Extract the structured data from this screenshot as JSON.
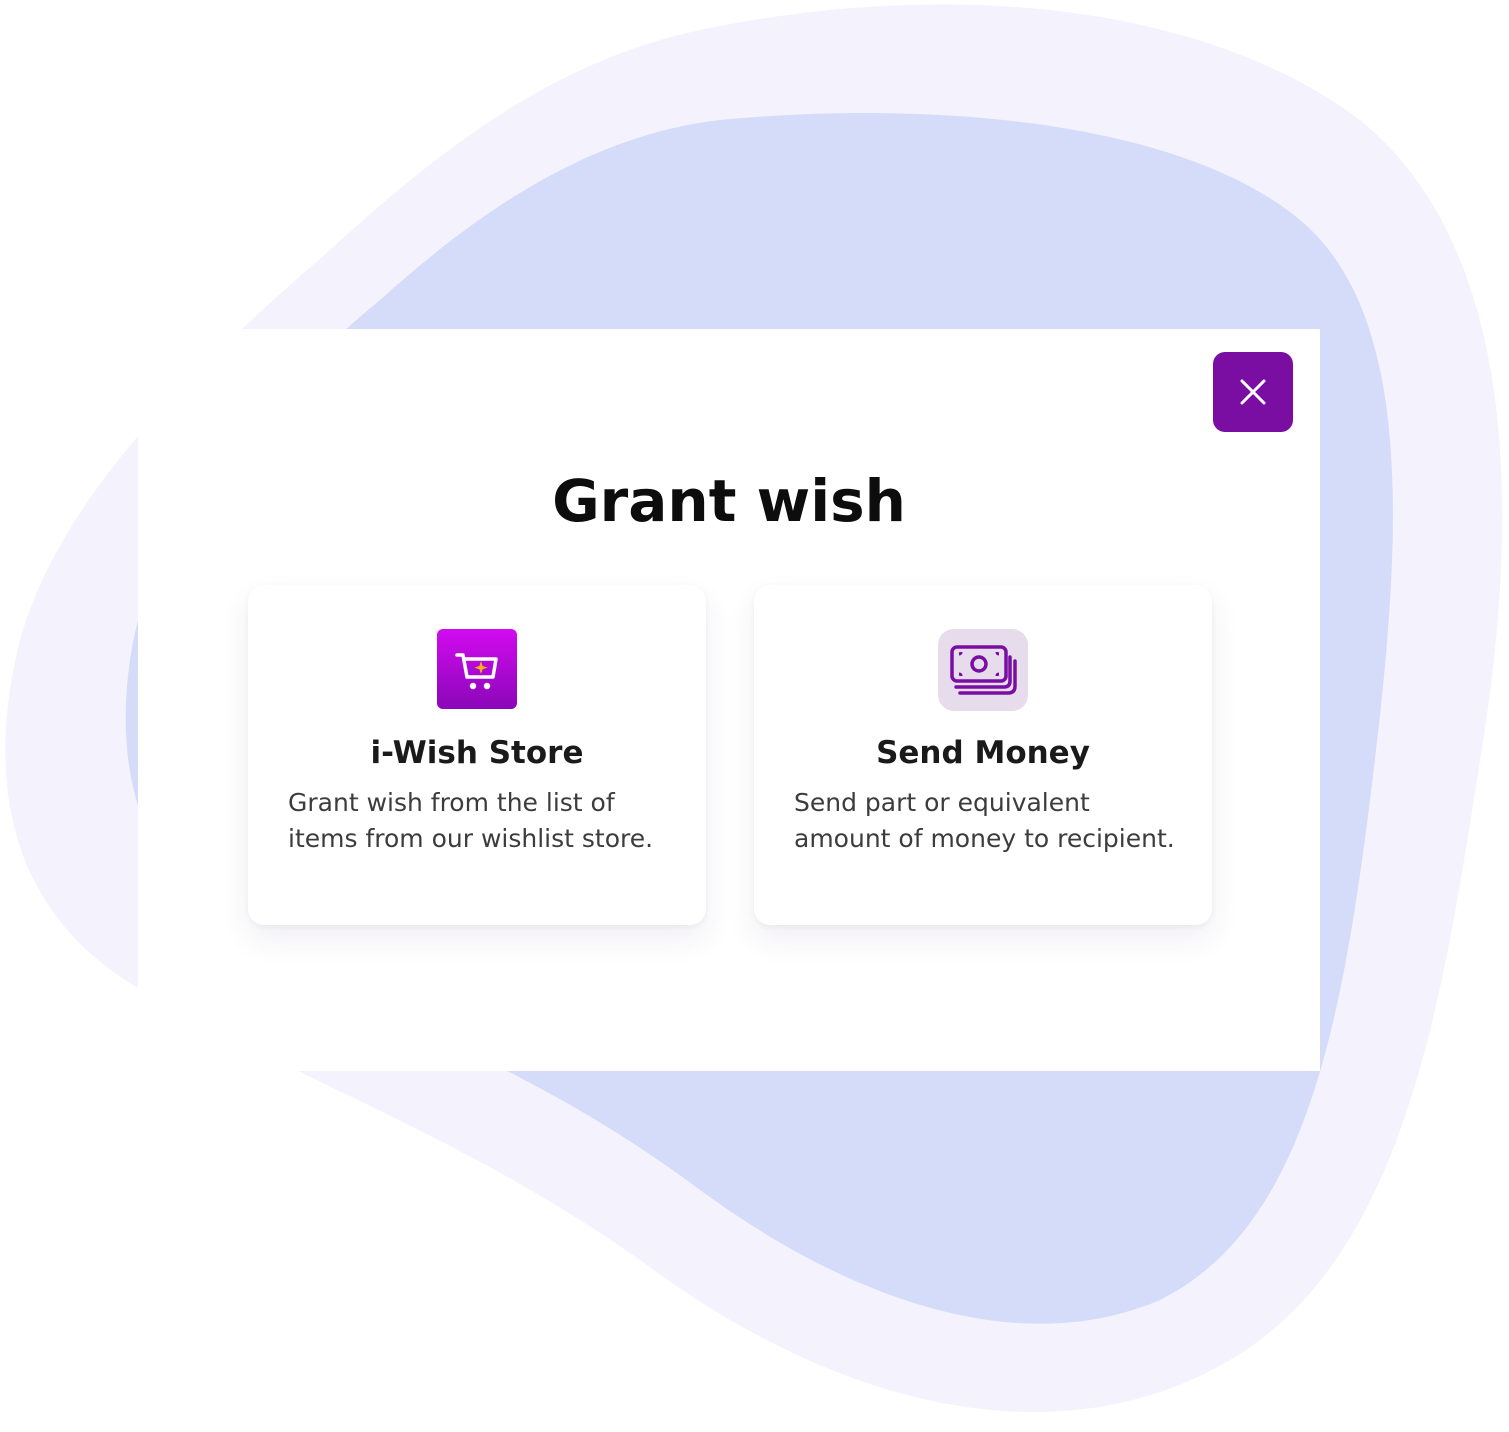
{
  "colors": {
    "accent": "#7a0ea3",
    "store_gradient_top": "#d20bef",
    "store_gradient_bottom": "#8a07b8",
    "money_tile_bg": "#e6dcec",
    "blob_outer": "#f4f2fd",
    "blob_inner": "#d5dcf9"
  },
  "modal": {
    "title": "Grant wish",
    "close_icon": "close-icon"
  },
  "options": [
    {
      "icon": "shopping-cart-icon",
      "title": "i-Wish Store",
      "description": "Grant wish from the list of items from our wishlist store."
    },
    {
      "icon": "money-stack-icon",
      "title": "Send Money",
      "description": "Send part or equivalent amount of money to recipient."
    }
  ]
}
